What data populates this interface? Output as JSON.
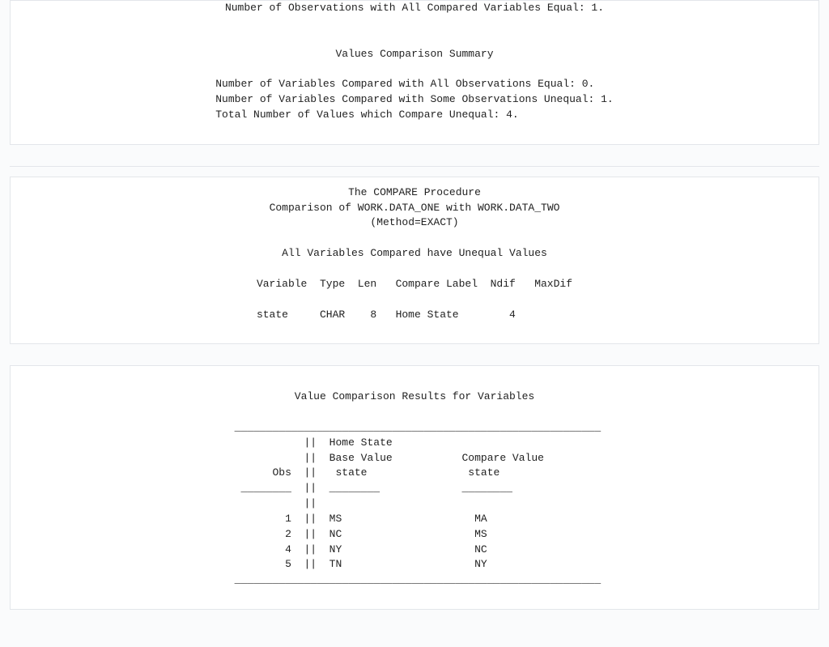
{
  "panel1": {
    "obs_equal_line": "Number of Observations with All Compared Variables Equal: 1.",
    "values_summary_title": "Values Comparison Summary",
    "vars_all_equal": "Number of Variables Compared with All Observations Equal: 0.",
    "vars_some_unequal": "Number of Variables Compared with Some Observations Unequal: 1.",
    "total_unequal": "Total Number of Values which Compare Unequal: 4."
  },
  "panel2": {
    "title1": "The COMPARE Procedure",
    "title2": "Comparison of WORK.DATA_ONE with WORK.DATA_TWO",
    "title3": "(Method=EXACT)",
    "subtitle": "All Variables Compared have Unequal Values",
    "header": "Variable  Type  Len   Compare Label  Ndif   MaxDif",
    "row": "state     CHAR    8   Home State        4"
  },
  "panel3": {
    "title": "Value Comparison Results for Variables",
    "hr_top": " __________________________________________________________",
    "hdr1": "            ||  Home State",
    "hdr2": "            ||  Base Value           Compare Value",
    "hdr3": "       Obs  ||   state                state",
    "hdr_sep": "  ________  ||  ________             ________",
    "hdr_blank": "            ||",
    "r1": "         1  ||  MS                     MA",
    "r2": "         2  ||  NC                     MS",
    "r3": "         4  ||  NY                     NC",
    "r4": "         5  ||  TN                     NY",
    "hr_bot": " __________________________________________________________"
  }
}
